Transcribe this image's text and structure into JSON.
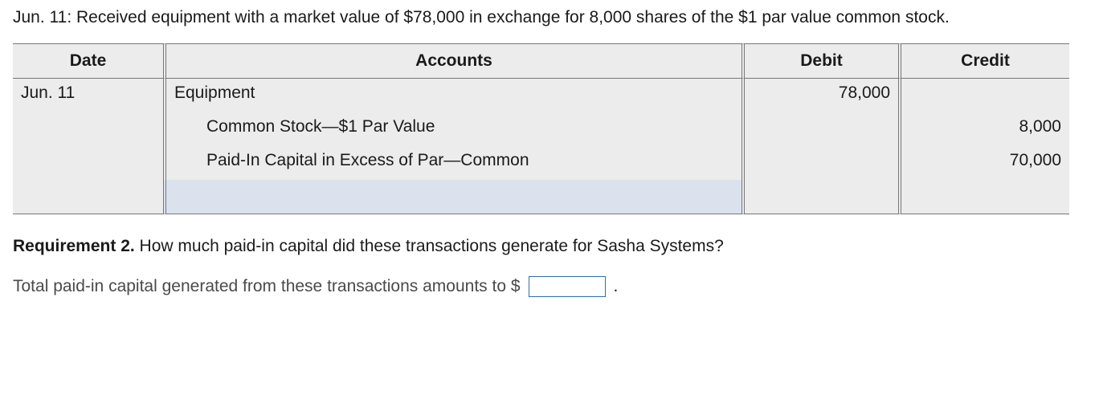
{
  "intro": "Jun. 11: Received equipment with a market value of $78,000 in exchange for 8,000 shares of the $1 par value common stock.",
  "headers": {
    "date": "Date",
    "accounts": "Accounts",
    "debit": "Debit",
    "credit": "Credit"
  },
  "rows": [
    {
      "date": "Jun. 11",
      "account": "Equipment",
      "indent": false,
      "debit": "78,000",
      "credit": ""
    },
    {
      "date": "",
      "account": "Common Stock—$1 Par Value",
      "indent": true,
      "debit": "",
      "credit": "8,000"
    },
    {
      "date": "",
      "account": "Paid-In Capital in Excess of Par—Common",
      "indent": true,
      "debit": "",
      "credit": "70,000"
    },
    {
      "date": "",
      "account": "",
      "indent": false,
      "debit": "",
      "credit": ""
    }
  ],
  "req2_lead": "Requirement 2.",
  "req2_text": " How much paid-in capital did these transactions generate for Sasha Systems?",
  "answer_label": "Total paid-in capital generated from these transactions amounts to $",
  "answer_value": "",
  "period": "."
}
